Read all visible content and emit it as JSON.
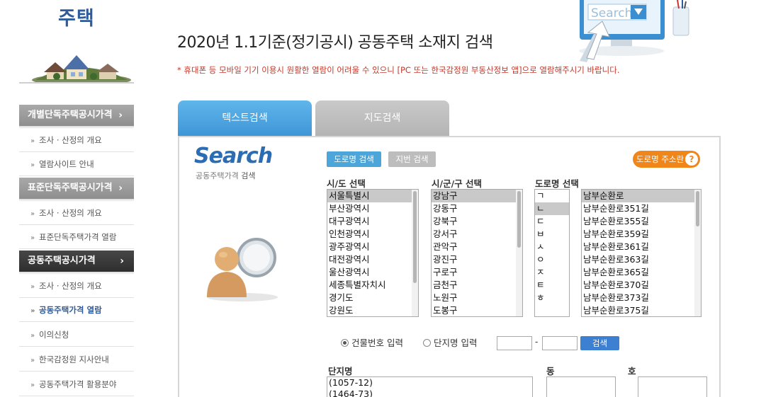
{
  "sidebar": {
    "title": "주택",
    "menus": [
      {
        "label": "개별단독주택공시가격",
        "items": [
          "조사 · 산정의 개요",
          "열람사이트 안내"
        ]
      },
      {
        "label": "표준단독주택공시가격",
        "items": [
          "조사 · 산정의 개요",
          "표준단독주택가격 열람"
        ]
      },
      {
        "label": "공동주택공시가격",
        "items": [
          "조사 · 산정의 개요",
          "공동주택가격 열람",
          "이의신청",
          "한국감정원 지사안내",
          "공동주택가격 활용분야"
        ]
      }
    ],
    "chevron": "›",
    "bullet": "»"
  },
  "header": {
    "title": "2020년 1.1기준(정기공시) 공동주택 소재지 검색",
    "notice": "* 휴대폰 등 모바일 기기 이용시 원활한 열람이 어려울 수 있으니 [PC 또는 한국감정원 부동산정보 앱]으로 열람해주시기 바랍니다.",
    "deco_text": "Search"
  },
  "tabs": [
    {
      "label": "텍스트검색",
      "active": true
    },
    {
      "label": "지도검색",
      "active": false
    }
  ],
  "search": {
    "logo": "Search",
    "sub_plain": "공동주택가격 ",
    "sub_bold": "검색",
    "road_btn": "도로명 검색",
    "jibun_btn": "지번 검색",
    "guide_btn": "도로명 주소란",
    "guide_icon": "?"
  },
  "lists": {
    "sido_label": "시/도 선택",
    "sido": [
      "서울특별시",
      "부산광역시",
      "대구광역시",
      "인천광역시",
      "광주광역시",
      "대전광역시",
      "울산광역시",
      "세종특별자치시",
      "경기도",
      "강원도"
    ],
    "sigungu_label": "시/군/구 선택",
    "sigungu": [
      "강남구",
      "강동구",
      "강북구",
      "강서구",
      "관악구",
      "광진구",
      "구로구",
      "금천구",
      "노원구",
      "도봉구"
    ],
    "road_label": "도로명 선택",
    "initials": [
      "ㄱ",
      "ㄴ",
      "ㄷ",
      "ㅂ",
      "ㅅ",
      "ㅇ",
      "ㅈ",
      "ㅌ",
      "ㅎ"
    ],
    "roads": [
      "남부순환로",
      "남부순환로351길",
      "남부순환로355길",
      "남부순환로359길",
      "남부순환로361길",
      "남부순환로363길",
      "남부순환로365길",
      "남부순환로370길",
      "남부순환로373길",
      "남부순환로375길"
    ]
  },
  "radio": {
    "building": "건물번호 입력",
    "complex": "단지명 입력",
    "dash": "-",
    "find_btn": "검색"
  },
  "bottom": {
    "complex_label": "단지명",
    "complex_items": [
      "(1057-12)",
      "(1464-73)"
    ],
    "dong_label": "동",
    "ho_label": "호"
  },
  "colors": {
    "accent_blue": "#3f96d6",
    "title_blue": "#2d5b9b",
    "notice_red": "#c0392b",
    "guide_orange": "#f08519"
  }
}
